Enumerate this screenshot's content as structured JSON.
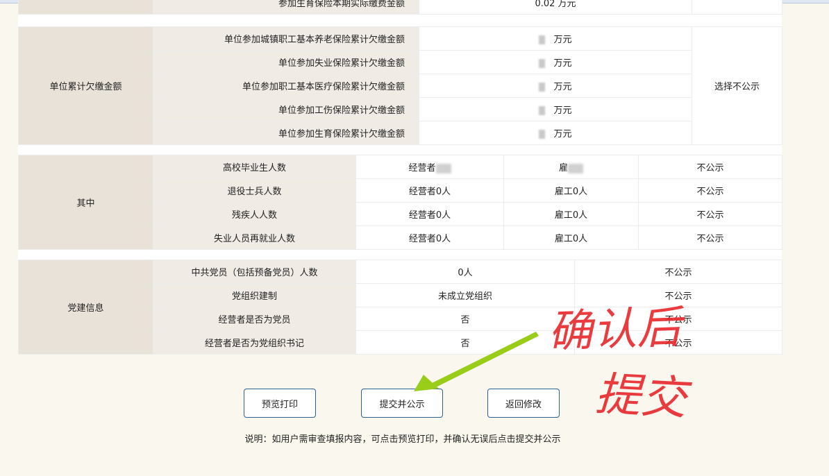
{
  "top_row": {
    "value": "0.02 万元"
  },
  "arrears": {
    "section": "单位累计欠缴金额",
    "rows": [
      {
        "label": "单位参加城镇职工基本养老保险累计欠缴金额",
        "unit": "万元"
      },
      {
        "label": "单位参加失业保险累计欠缴金额",
        "unit": "万元"
      },
      {
        "label": "单位参加职工基本医疗保险累计欠缴金额",
        "unit": "万元"
      },
      {
        "label": "单位参加工伤保险累计欠缴金额",
        "unit": "万元"
      },
      {
        "label": "单位参加生育保险累计欠缴金额",
        "unit": "万元"
      }
    ],
    "publicity": "选择不公示"
  },
  "among": {
    "section": "其中",
    "rows": [
      {
        "label": "高校毕业生人数",
        "owners": "经营者",
        "employees": "雇",
        "publicity": "不公示"
      },
      {
        "label": "退役士兵人数",
        "owners": "经营者0人",
        "employees": "雇工0人",
        "publicity": "不公示"
      },
      {
        "label": "残疾人人数",
        "owners": "经营者0人",
        "employees": "雇工0人",
        "publicity": "不公示"
      },
      {
        "label": "失业人员再就业人数",
        "owners": "经营者0人",
        "employees": "雇工0人",
        "publicity": "不公示"
      }
    ]
  },
  "party": {
    "section": "党建信息",
    "rows": [
      {
        "label": "中共党员（包括预备党员）人数",
        "value": "0人",
        "publicity": "不公示"
      },
      {
        "label": "党组织建制",
        "value": "未成立党组织",
        "publicity": "不公示"
      },
      {
        "label": "经营者是否为党员",
        "value": "否",
        "publicity": "不公示"
      },
      {
        "label": "经营者是否为党组织书记",
        "value": "否",
        "publicity": "不公示"
      }
    ]
  },
  "buttons": {
    "preview": "预览打印",
    "submit": "提交并公示",
    "back": "返回修改"
  },
  "note": "说明：如用户需审查填报内容，可点击预览打印，并确认无误后点击提交并公示",
  "annotation": {
    "line1": "确认后",
    "line2": "提交",
    "color": "#e8262a",
    "arrow_color": "#9acd1a"
  }
}
